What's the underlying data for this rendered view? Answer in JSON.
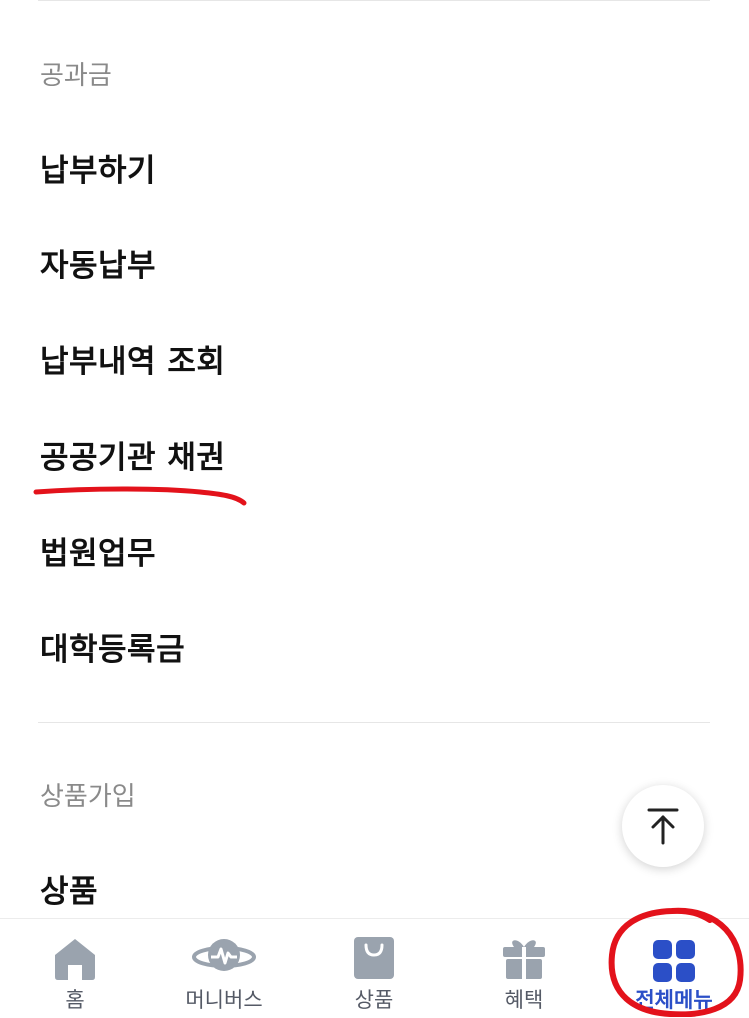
{
  "sections": [
    {
      "title": "공과금",
      "items": [
        "납부하기",
        "자동납부",
        "납부내역 조회",
        "공공기관 채권",
        "법원업무",
        "대학등록금"
      ]
    },
    {
      "title": "상품가입",
      "items": [
        "상품"
      ]
    }
  ],
  "tabbar": {
    "tabs": [
      {
        "label": "홈",
        "icon": "home-icon"
      },
      {
        "label": "머니버스",
        "icon": "planet-icon"
      },
      {
        "label": "상품",
        "icon": "shopping-bag-icon"
      },
      {
        "label": "혜택",
        "icon": "gift-icon"
      },
      {
        "label": "전체메뉴",
        "icon": "grid-menu-icon"
      }
    ],
    "active_index": 4
  },
  "scroll_top_icon": "arrow-up-icon",
  "colors": {
    "accent": "#2b4fc7",
    "inactive_icon": "#9aa3ae",
    "annotation": "#e3121b",
    "section_title": "#8a8a8a",
    "item_text": "#111111"
  }
}
